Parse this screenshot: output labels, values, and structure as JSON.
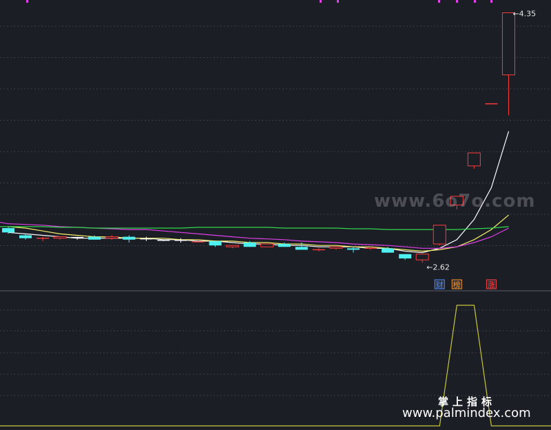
{
  "colors": {
    "background": "#1c1e26",
    "up": "#ff3a3a",
    "down": "#4ff0f0",
    "ma_white": "#ffffff",
    "ma_yellow": "#f5f06a",
    "ma_magenta": "#e040e8",
    "ma_green": "#2fd84a",
    "indicator": "#c8c83a",
    "grid": "#3a3d4a"
  },
  "chart_data": {
    "type": "candlestick",
    "price_range": [
      2.55,
      4.4
    ],
    "candles": [
      {
        "o": 2.86,
        "h": 2.87,
        "l": 2.82,
        "c": 2.83
      },
      {
        "o": 2.81,
        "h": 2.82,
        "l": 2.78,
        "c": 2.79
      },
      {
        "o": 2.79,
        "h": 2.8,
        "l": 2.77,
        "c": 2.79
      },
      {
        "o": 2.79,
        "h": 2.8,
        "l": 2.78,
        "c": 2.8
      },
      {
        "o": 2.795,
        "h": 2.8,
        "l": 2.78,
        "c": 2.79
      },
      {
        "o": 2.8,
        "h": 2.81,
        "l": 2.78,
        "c": 2.78
      },
      {
        "o": 2.79,
        "h": 2.81,
        "l": 2.78,
        "c": 2.8
      },
      {
        "o": 2.8,
        "h": 2.81,
        "l": 2.76,
        "c": 2.78
      },
      {
        "o": 2.785,
        "h": 2.8,
        "l": 2.77,
        "c": 2.78
      },
      {
        "o": 2.775,
        "h": 2.78,
        "l": 2.77,
        "c": 2.77
      },
      {
        "o": 2.775,
        "h": 2.79,
        "l": 2.76,
        "c": 2.77
      },
      {
        "o": 2.765,
        "h": 2.77,
        "l": 2.76,
        "c": 2.765
      },
      {
        "o": 2.77,
        "h": 2.77,
        "l": 2.73,
        "c": 2.74
      },
      {
        "o": 2.73,
        "h": 2.74,
        "l": 2.72,
        "c": 2.74
      },
      {
        "o": 2.76,
        "h": 2.77,
        "l": 2.73,
        "c": 2.73
      },
      {
        "o": 2.73,
        "h": 2.75,
        "l": 2.73,
        "c": 2.75
      },
      {
        "o": 2.75,
        "h": 2.76,
        "l": 2.73,
        "c": 2.73
      },
      {
        "o": 2.73,
        "h": 2.76,
        "l": 2.71,
        "c": 2.71
      },
      {
        "o": 2.71,
        "h": 2.72,
        "l": 2.7,
        "c": 2.71
      },
      {
        "o": 2.72,
        "h": 2.73,
        "l": 2.71,
        "c": 2.73
      },
      {
        "o": 2.72,
        "h": 2.73,
        "l": 2.69,
        "c": 2.71
      },
      {
        "o": 2.72,
        "h": 2.73,
        "l": 2.71,
        "c": 2.72
      },
      {
        "o": 2.72,
        "h": 2.73,
        "l": 2.69,
        "c": 2.69
      },
      {
        "o": 2.68,
        "h": 2.68,
        "l": 2.64,
        "c": 2.65
      },
      {
        "o": 2.64,
        "h": 2.68,
        "l": 2.62,
        "c": 2.68
      },
      {
        "o": 2.75,
        "h": 2.88,
        "l": 2.74,
        "c": 2.88
      },
      {
        "o": 3.02,
        "h": 3.08,
        "l": 2.99,
        "c": 3.08
      },
      {
        "o": 3.29,
        "h": 3.38,
        "l": 3.27,
        "c": 3.38
      },
      {
        "o": 3.72,
        "h": 3.72,
        "l": 3.72,
        "c": 3.72
      },
      {
        "o": 3.92,
        "h": 4.35,
        "l": 3.64,
        "c": 4.35
      }
    ],
    "ma": [
      {
        "color_key": "ma_white",
        "values": [
          2.83,
          2.82,
          2.81,
          2.8,
          2.79,
          2.79,
          2.79,
          2.79,
          2.79,
          2.78,
          2.78,
          2.77,
          2.77,
          2.76,
          2.75,
          2.75,
          2.74,
          2.74,
          2.73,
          2.73,
          2.73,
          2.72,
          2.72,
          2.7,
          2.69,
          2.72,
          2.78,
          2.92,
          3.14,
          3.53
        ]
      },
      {
        "color_key": "ma_yellow",
        "values": [
          2.87,
          2.86,
          2.84,
          2.82,
          2.81,
          2.8,
          2.8,
          2.79,
          2.79,
          2.79,
          2.78,
          2.78,
          2.77,
          2.77,
          2.76,
          2.76,
          2.75,
          2.75,
          2.74,
          2.74,
          2.73,
          2.73,
          2.72,
          2.71,
          2.7,
          2.71,
          2.73,
          2.78,
          2.85,
          2.95
        ]
      },
      {
        "color_key": "ma_magenta",
        "values": [
          2.89,
          2.885,
          2.88,
          2.87,
          2.865,
          2.86,
          2.855,
          2.85,
          2.85,
          2.84,
          2.83,
          2.82,
          2.81,
          2.8,
          2.79,
          2.785,
          2.78,
          2.77,
          2.765,
          2.76,
          2.75,
          2.745,
          2.74,
          2.73,
          2.72,
          2.72,
          2.73,
          2.76,
          2.8,
          2.86
        ]
      },
      {
        "color_key": "ma_green",
        "values": [
          2.87,
          2.87,
          2.87,
          2.865,
          2.865,
          2.86,
          2.86,
          2.86,
          2.86,
          2.86,
          2.86,
          2.865,
          2.865,
          2.865,
          2.865,
          2.865,
          2.86,
          2.86,
          2.86,
          2.86,
          2.855,
          2.855,
          2.85,
          2.85,
          2.85,
          2.85,
          2.85,
          2.855,
          2.86,
          2.87
        ]
      }
    ],
    "annotations": {
      "high_label": "4.35",
      "low_label": "2.62"
    },
    "tags": [
      {
        "index": 25,
        "text": "财",
        "color": "#4a90ff"
      },
      {
        "index": 26,
        "text": "榜",
        "color": "#ff9a30"
      },
      {
        "index": 28,
        "text": "涨",
        "color": "#ff4040"
      }
    ],
    "indicator": {
      "values": [
        0,
        0,
        0,
        0,
        0,
        0,
        0,
        0,
        0,
        0,
        0,
        0,
        0,
        0,
        0,
        0,
        0,
        0,
        0,
        0,
        0,
        0,
        0,
        0,
        0,
        0,
        1,
        1,
        0,
        0
      ]
    }
  },
  "watermarks": {
    "site": "www.6o7o.com",
    "cn": "掌上指标",
    "url": "www.palmindex.com"
  }
}
